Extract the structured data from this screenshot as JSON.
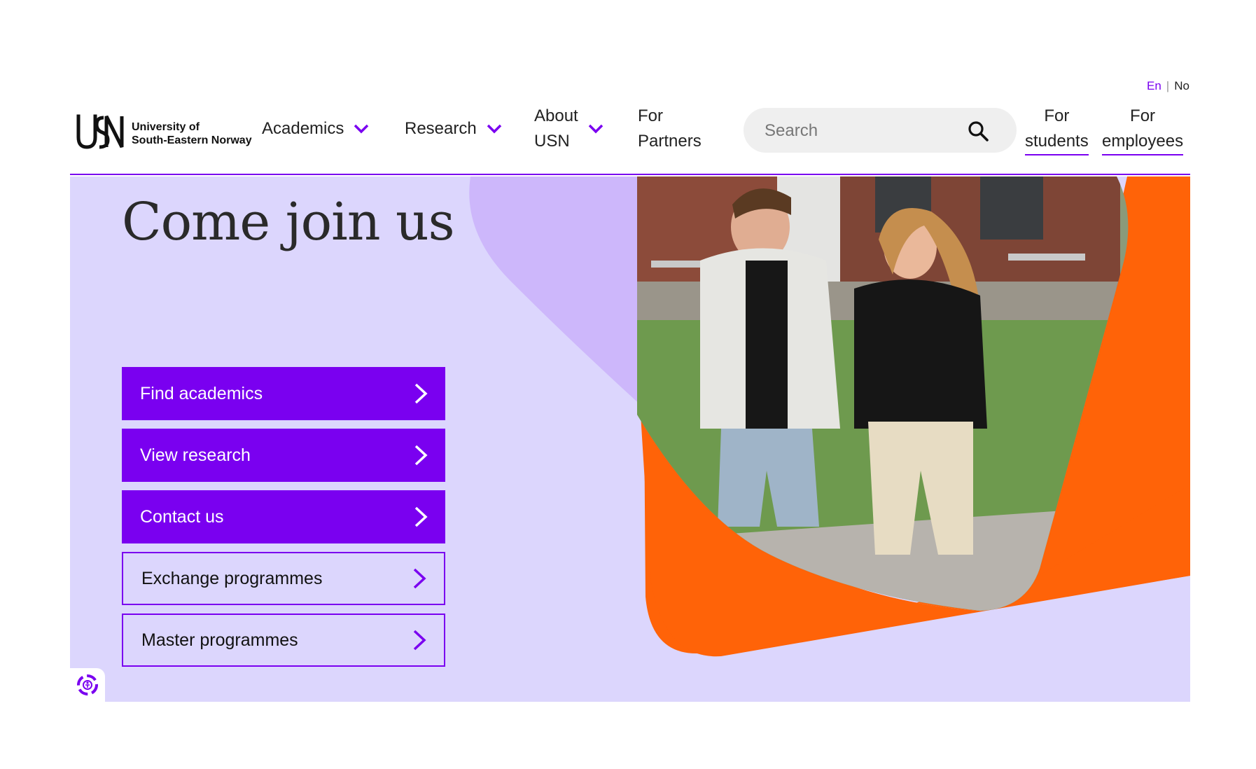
{
  "lang": {
    "en": "En",
    "separator": "|",
    "no": "No"
  },
  "logo": {
    "mark": "USN",
    "line1": "University of",
    "line2": "South-Eastern Norway"
  },
  "nav": {
    "academics": "Academics",
    "research": "Research",
    "about_line1": "About",
    "about_line2": "USN",
    "partners_line1": "For",
    "partners_line2": "Partners"
  },
  "search": {
    "placeholder": "Search",
    "icon": "search-icon"
  },
  "top_links": {
    "students_line1": "For",
    "students_line2": "students",
    "employees_line1": "For",
    "employees_line2": "employees"
  },
  "hero": {
    "title": "Come join us",
    "buttons": [
      {
        "label": "Find academics"
      },
      {
        "label": "View research"
      },
      {
        "label": "Contact us"
      },
      {
        "label": "Exchange programmes"
      },
      {
        "label": "Master programmes"
      }
    ]
  },
  "colors": {
    "accent": "#7a00f0",
    "hero_bg": "#dcd6fd",
    "lavender_shape": "#cdb7fb",
    "orange_shape": "#ff6308"
  },
  "icons": {
    "chevron": "chevron-down-icon",
    "arrow": "chevron-right-icon",
    "accessibility": "accessibility-icon"
  }
}
